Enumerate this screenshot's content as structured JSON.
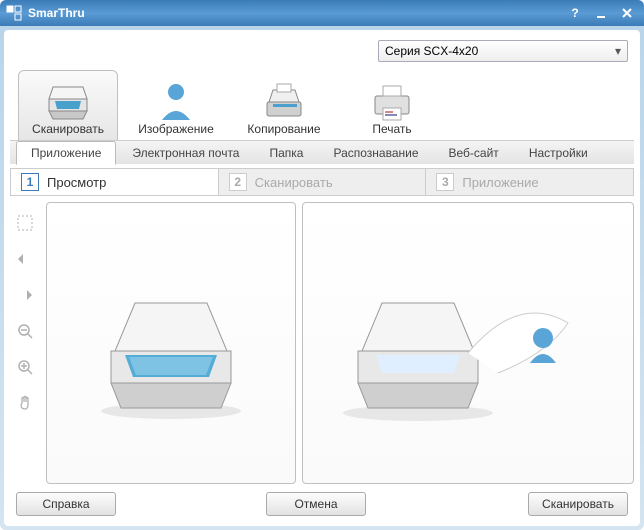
{
  "window": {
    "title": "SmarThru"
  },
  "device": {
    "selected": "Серия SCX-4x20"
  },
  "bigTabs": {
    "scan": "Сканировать",
    "image": "Изображение",
    "copy": "Копирование",
    "print": "Печать"
  },
  "subtabs": {
    "application": "Приложение",
    "email": "Электронная почта",
    "folder": "Папка",
    "ocr": "Распознавание",
    "website": "Веб-сайт",
    "settings": "Настройки"
  },
  "steps": {
    "s1": {
      "num": "1",
      "label": "Просмотр"
    },
    "s2": {
      "num": "2",
      "label": "Сканировать"
    },
    "s3": {
      "num": "3",
      "label": "Приложение"
    }
  },
  "buttons": {
    "help": "Справка",
    "cancel": "Отмена",
    "scan": "Сканировать"
  }
}
